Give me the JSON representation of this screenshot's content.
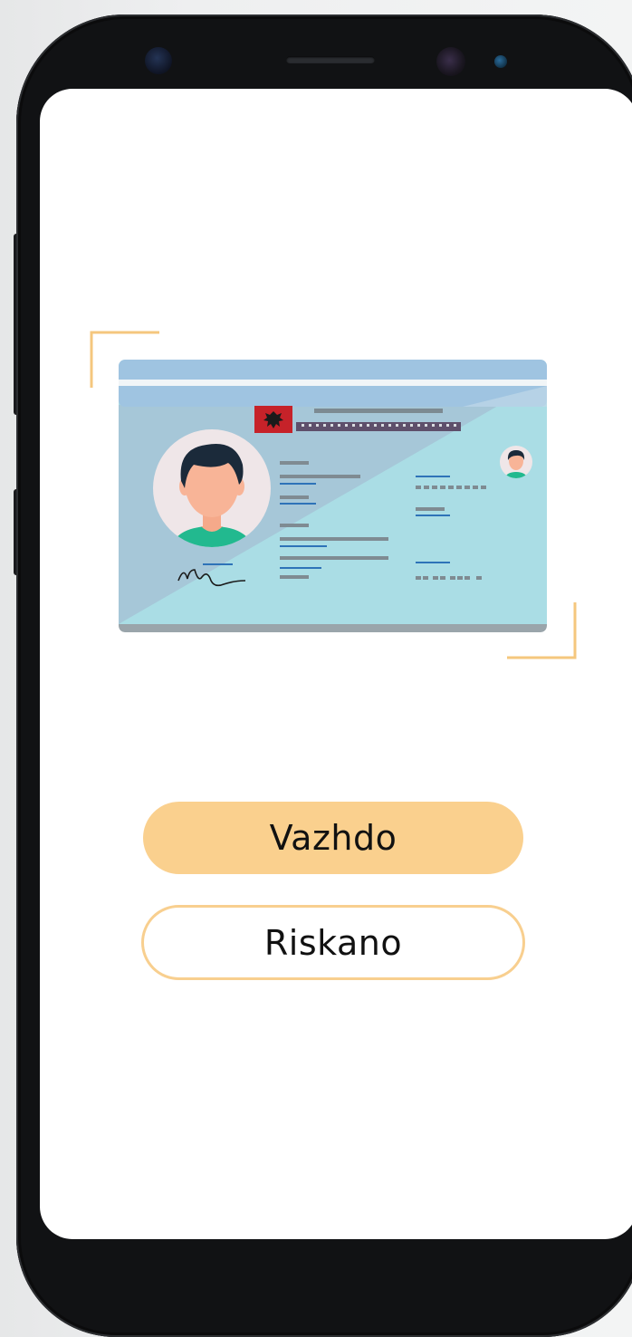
{
  "screen": {
    "actions": {
      "continue_label": "Vazhdo",
      "rescan_label": "Riskano"
    },
    "id_card": {
      "flag": "albania-flag-icon"
    }
  },
  "colors": {
    "accent": "#fad08e",
    "accent_border": "#f8cf8f",
    "bracket": "#f5c77e",
    "card_header": "#9fc4e1",
    "card_body": "#a9dce4",
    "text": "#111111"
  }
}
